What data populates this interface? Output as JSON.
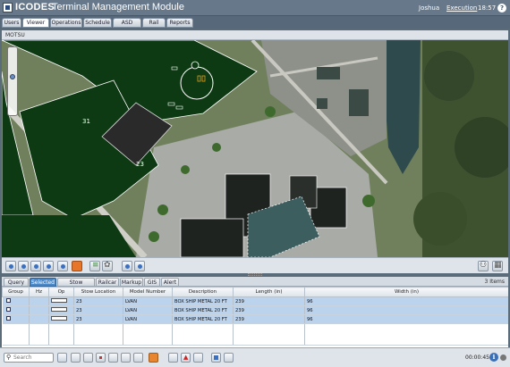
{
  "header": {
    "brand": "ICODES",
    "title": "Terminal Management Module",
    "user": "Joshua",
    "mode": "Execution",
    "time": "18:57",
    "help_glyph": "?"
  },
  "main_tabs": [
    {
      "label": "Users"
    },
    {
      "label": "Viewer",
      "active": true
    },
    {
      "label": "Operations"
    },
    {
      "label": "Schedule"
    },
    {
      "label": "ASD"
    },
    {
      "label": "Rail"
    },
    {
      "label": "Reports"
    }
  ],
  "panel": {
    "title": "MOTSU"
  },
  "map": {
    "lot_labels": [
      "31",
      "23"
    ]
  },
  "sub_tabs": [
    {
      "label": "Query"
    },
    {
      "label": "Selected",
      "active": true
    },
    {
      "label": "Stow Location"
    },
    {
      "label": "Railcar"
    },
    {
      "label": "Markup"
    },
    {
      "label": "GIS"
    },
    {
      "label": "Alert"
    }
  ],
  "items_count": "3 Items",
  "table": {
    "columns": [
      "Group",
      "Hz",
      "Op",
      "Stow Location",
      "Model Number",
      "Description",
      "Length (in)",
      "Width (in)"
    ],
    "rows": [
      {
        "stow": "23",
        "model": "LVAN",
        "desc": "BOX SHIP METAL 20 FT",
        "length": "239",
        "width": "96"
      },
      {
        "stow": "23",
        "model": "LVAN",
        "desc": "BOX SHIP METAL 20 FT",
        "length": "239",
        "width": "96"
      },
      {
        "stow": "23",
        "model": "LVAN",
        "desc": "BOX SHIP METAL 20 FT",
        "length": "239",
        "width": "96"
      }
    ]
  },
  "bottom": {
    "search_placeholder": "Search",
    "timer": "00:00:45",
    "info_glyph": "i"
  }
}
